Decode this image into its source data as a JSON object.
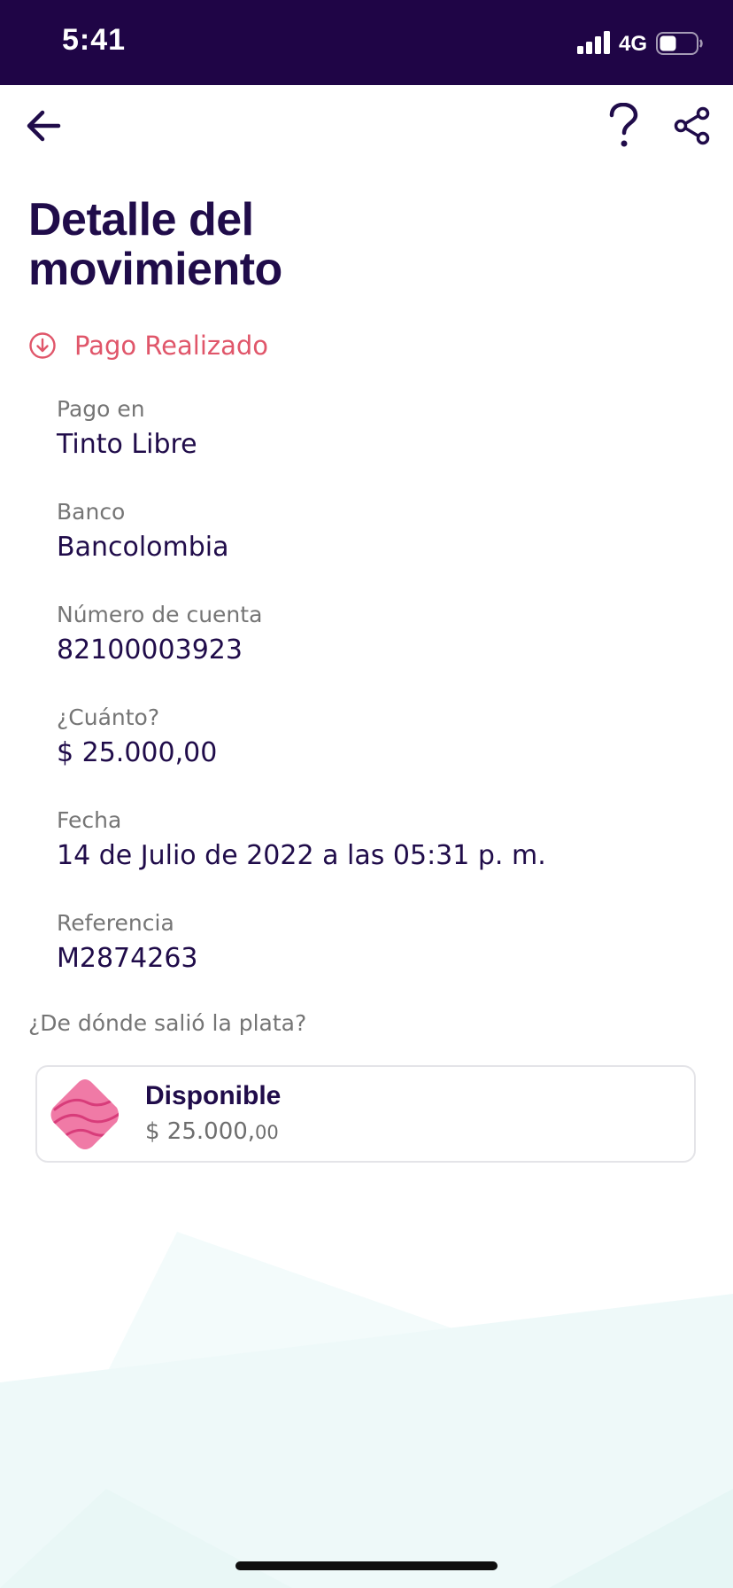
{
  "status_bar": {
    "time": "5:41",
    "network": "4G",
    "background": "#1f0546"
  },
  "header": {
    "back_icon": "arrow-left-icon",
    "help_label": "?",
    "share_icon": "share-icon"
  },
  "page": {
    "title": "Detalle del movimiento",
    "status_label": "Pago Realizado",
    "status_color": "#e0566a",
    "status_icon": "arrow-down-circle-icon"
  },
  "details": [
    {
      "label": "Pago en",
      "value": "Tinto Libre"
    },
    {
      "label": "Banco",
      "value": "Bancolombia"
    },
    {
      "label": "Número de cuenta",
      "value": "82100003923"
    },
    {
      "label": "¿Cuánto?",
      "value": "$ 25.000,00"
    },
    {
      "label": "Fecha",
      "value": "14 de Julio de 2022 a las 05:31 p. m."
    },
    {
      "label": "Referencia",
      "value": "M2874263"
    }
  ],
  "source": {
    "question": "¿De dónde salió la plata?",
    "name": "Disponible",
    "amount_main": "$ 25.000,",
    "amount_cents": "00",
    "icon": "pocket-pink-icon",
    "icon_color": "#f07aa6"
  },
  "colors": {
    "primary_text": "#200c4a",
    "secondary_text": "#757575",
    "accent_pink": "#e0566a",
    "background_decoration": "#eaf8f7"
  }
}
